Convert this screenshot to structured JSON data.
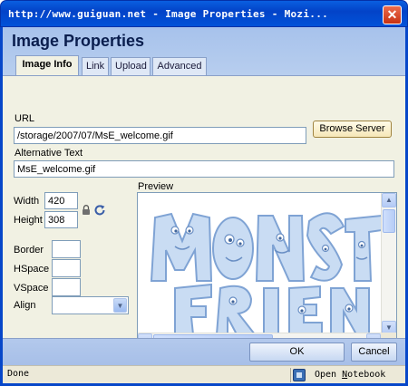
{
  "window": {
    "title": "http://www.guiguan.net - Image Properties - Mozi...",
    "close_glyph": "✕"
  },
  "dialog": {
    "title": "Image Properties",
    "tabs": [
      {
        "label": "Image Info",
        "active": true
      },
      {
        "label": "Link",
        "active": false
      },
      {
        "label": "Upload",
        "active": false
      },
      {
        "label": "Advanced",
        "active": false
      }
    ]
  },
  "image_info": {
    "url_label": "URL",
    "url_value": "/storage/2007/07/MsE_welcome.gif",
    "browse_label": "Browse Server",
    "alt_label": "Alternative Text",
    "alt_value": "MsE_welcome.gif",
    "width_label": "Width",
    "width_value": "420",
    "height_label": "Height",
    "height_value": "308",
    "lock_icon": "lock-icon",
    "reset_icon": "reset-size-icon",
    "border_label": "Border",
    "border_value": "",
    "hspace_label": "HSpace",
    "hspace_value": "",
    "vspace_label": "VSpace",
    "vspace_value": "",
    "align_label": "Align",
    "align_value": "",
    "preview_label": "Preview"
  },
  "footer": {
    "ok_label": "OK",
    "cancel_label": "Cancel"
  },
  "statusbar": {
    "status": "Done",
    "notebook_label_pre": "Open ",
    "notebook_label_underlined": "N",
    "notebook_label_post": "otebook"
  },
  "colors": {
    "title_bar": "#0343c8",
    "dialog_head": "#a7c2ec",
    "panel_bg": "#f1f1e3",
    "preview_ink": "#9ec0e6"
  }
}
